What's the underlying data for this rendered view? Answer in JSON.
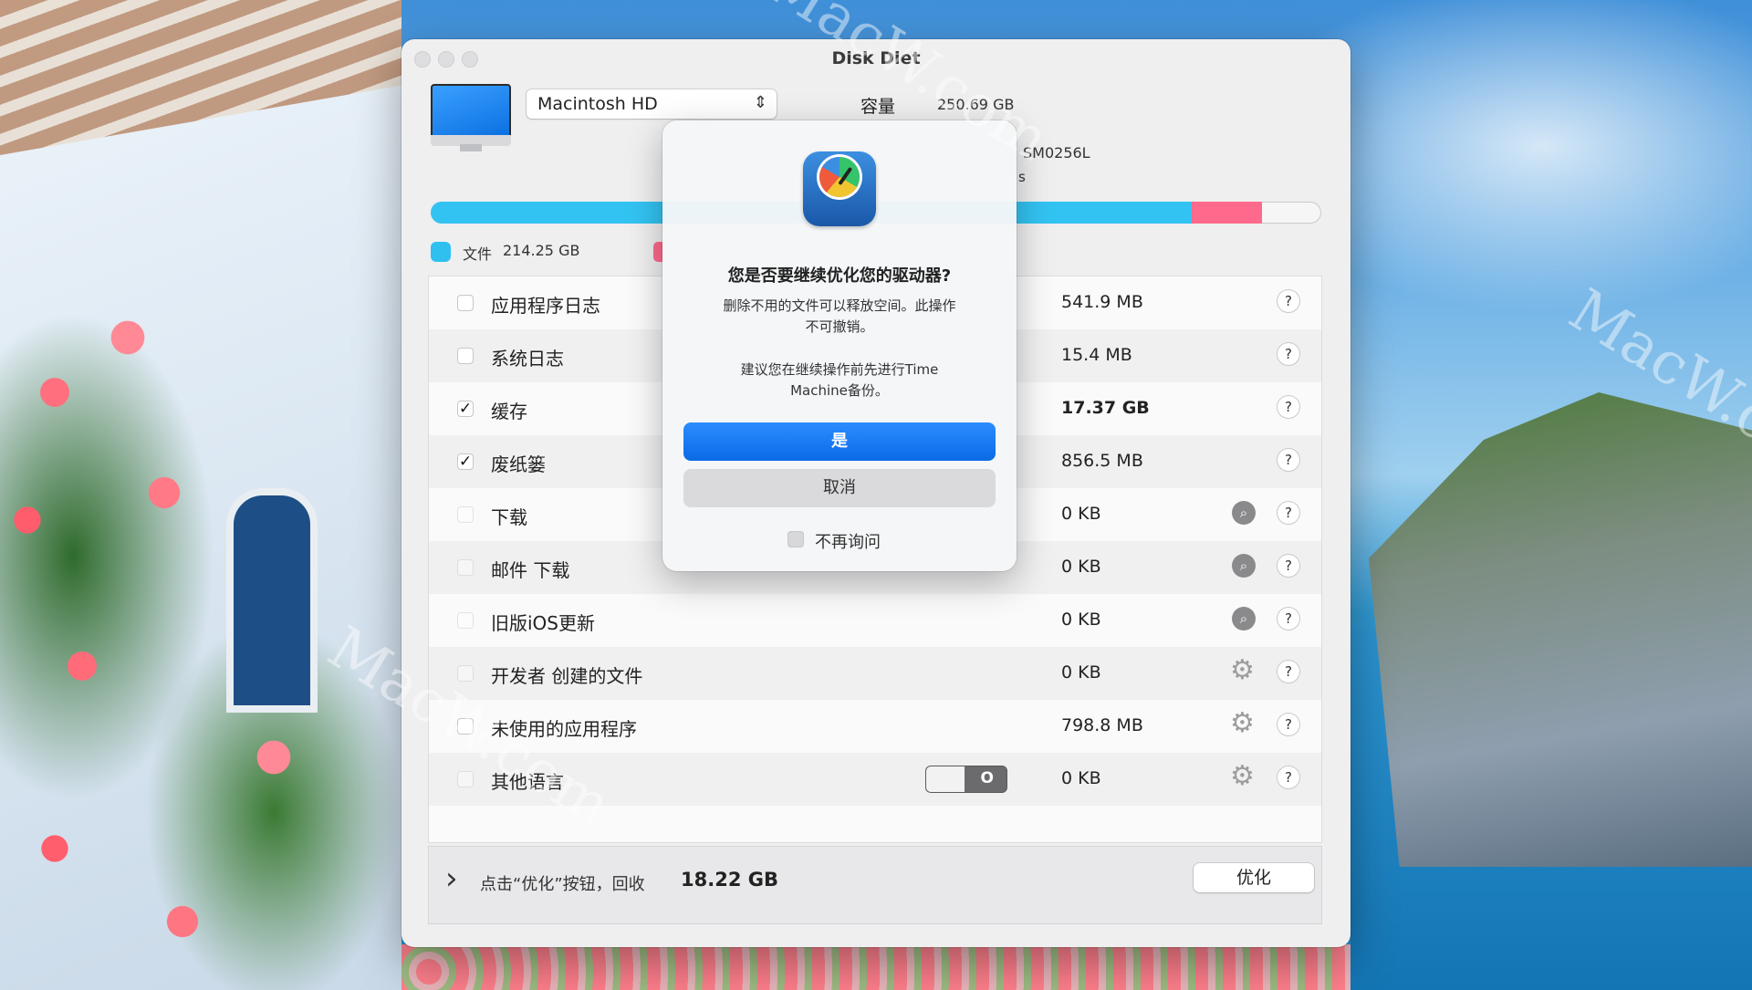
{
  "window": {
    "title": "Disk Diet"
  },
  "disk": {
    "selected": "Macintosh HD",
    "capacity_label": "容量",
    "capacity_value": "250.69 GB",
    "model": "SM0256L",
    "model_suffix": "s"
  },
  "usage": {
    "files_fraction": 0.855,
    "pink_fraction": 0.078
  },
  "legend": {
    "files_label": "文件",
    "files_value": "214.25 GB"
  },
  "items": [
    {
      "label": "应用程序日志",
      "size": "541.9 MB",
      "checked": false,
      "action": "none"
    },
    {
      "label": "系统日志",
      "size": "15.4 MB",
      "checked": false,
      "action": "none"
    },
    {
      "label": "缓存",
      "size": "17.37 GB",
      "checked": true,
      "action": "none"
    },
    {
      "label": "废纸篓",
      "size": "856.5 MB",
      "checked": true,
      "action": "none"
    },
    {
      "label": "下载",
      "size": "0 KB",
      "checked": false,
      "action": "search-icon"
    },
    {
      "label": "邮件 下载",
      "size": "0 KB",
      "checked": false,
      "action": "search-icon"
    },
    {
      "label": "旧版iOS更新",
      "size": "0 KB",
      "checked": false,
      "action": "search-icon"
    },
    {
      "label": "开发者 创建的文件",
      "size": "0 KB",
      "checked": false,
      "action": "gear-icon"
    },
    {
      "label": "未使用的应用程序",
      "size": "798.8 MB",
      "checked": false,
      "action": "gear-icon"
    },
    {
      "label": "其他语言",
      "size": "0 KB",
      "checked": false,
      "action": "gear-icon"
    }
  ],
  "help_symbol": "?",
  "toggle": {
    "state_text": "O"
  },
  "footer": {
    "text": "点击“优化”按钮，回收",
    "amount": "18.22 GB",
    "optimize_label": "优化"
  },
  "dialog": {
    "title": "您是否要继续优化您的驱动器?",
    "message_line1": "删除不用的文件可以释放空间。此操作",
    "message_line2": "不可撤销。",
    "message2_line1": "建议您在继续操作前先进行Time",
    "message2_line2": "Machine备份。",
    "yes_label": "是",
    "cancel_label": "取消",
    "dont_ask_label": "不再询问"
  },
  "watermark": "MacW.com",
  "colors": {
    "accent": "#0a6ae6",
    "files": "#33c3f2",
    "pink": "#ff6a8c"
  }
}
